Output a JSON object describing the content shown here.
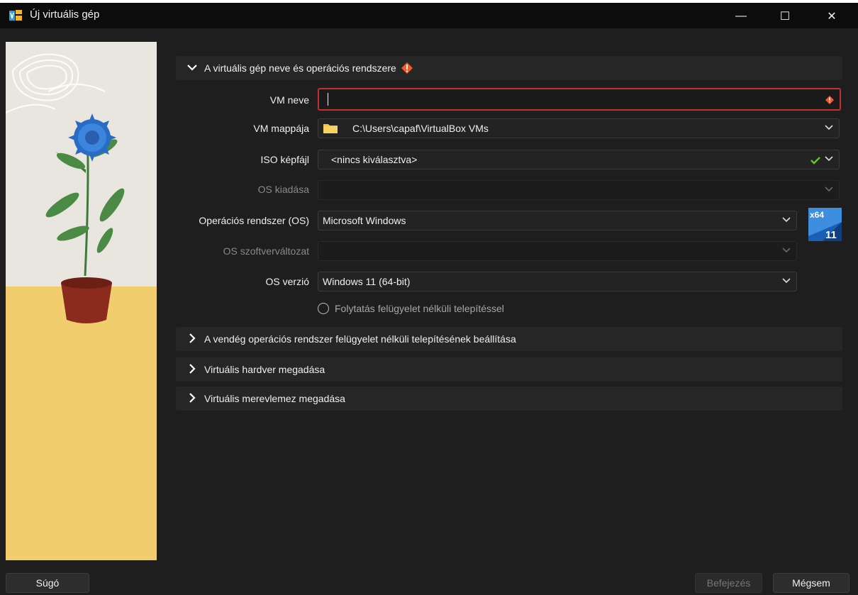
{
  "window": {
    "title": "Új virtuális gép",
    "controls": {
      "minimize": "—",
      "maximize": "☐",
      "close": "✕"
    }
  },
  "sections": [
    {
      "label": "A virtuális gép neve és operációs rendszere",
      "expanded": true,
      "warning": true
    },
    {
      "label": "A vendég operációs rendszer felügyelet nélküli telepítésének beállítása",
      "expanded": false
    },
    {
      "label": "Virtuális hardver megadása",
      "expanded": false
    },
    {
      "label": "Virtuális merevlemez megadása",
      "expanded": false
    }
  ],
  "form": {
    "vm_name": {
      "label": "VM neve",
      "value": ""
    },
    "vm_folder": {
      "label": "VM mappája",
      "value": "C:\\Users\\capaf\\VirtualBox VMs"
    },
    "iso": {
      "label": "ISO képfájl",
      "value": "<nincs kiválasztva>"
    },
    "os_edition": {
      "label": "OS kiadása",
      "value": ""
    },
    "os_type": {
      "label": "Operációs rendszer (OS)",
      "value": "Microsoft Windows"
    },
    "os_subtype": {
      "label": "OS szoftverváltozat",
      "value": ""
    },
    "os_version": {
      "label": "OS verzió",
      "value": "Windows 11 (64-bit)"
    },
    "unattended": {
      "label": "Folytatás felügyelet nélküli telepítéssel",
      "checked": false
    }
  },
  "os_badge": {
    "arch": "x64",
    "version": "11"
  },
  "footer": {
    "help": "Súgó",
    "finish": "Befejezés",
    "cancel": "Mégsem"
  },
  "colors": {
    "accent_error": "#c23030",
    "warning_orange": "#f15a29",
    "ok_green": "#6bbf2a"
  }
}
